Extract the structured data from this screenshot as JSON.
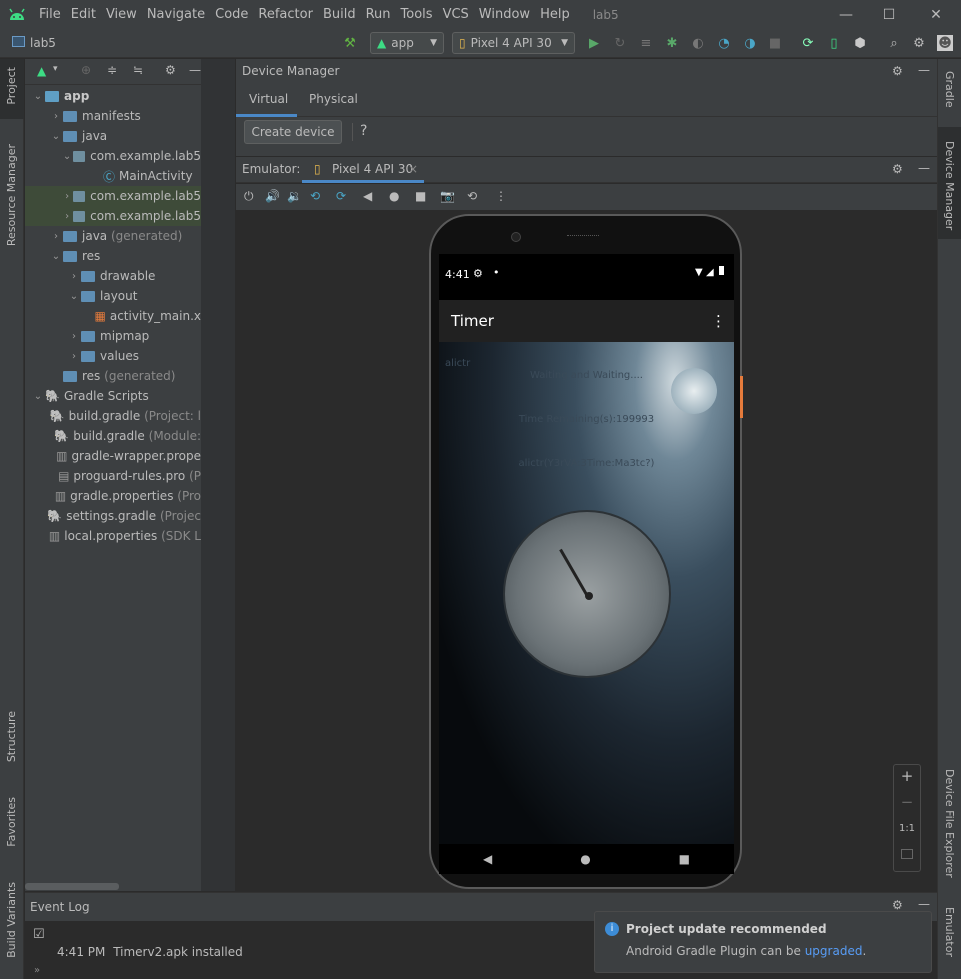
{
  "menu": {
    "items": [
      "File",
      "Edit",
      "View",
      "Navigate",
      "Code",
      "Refactor",
      "Build",
      "Run",
      "Tools",
      "VCS",
      "Window",
      "Help"
    ],
    "title": "lab5"
  },
  "toolbar": {
    "project": "lab5",
    "run_config": "app",
    "device": "Pixel 4 API 30"
  },
  "left_strip": {
    "project": "Project",
    "resource_manager": "Resource Manager",
    "structure": "Structure",
    "favorites": "Favorites",
    "build_variants": "Build Variants"
  },
  "right_strip": {
    "gradle": "Gradle",
    "device_manager": "Device Manager",
    "device_file_explorer": "Device File Explorer",
    "emulator": "Emulator"
  },
  "tree": [
    {
      "label": "app",
      "extra": ""
    },
    {
      "label": "manifests",
      "extra": ""
    },
    {
      "label": "java",
      "extra": ""
    },
    {
      "label": "com.example.lab5",
      "extra": ""
    },
    {
      "label": "MainActivity",
      "extra": ""
    },
    {
      "label": "com.example.lab5",
      "extra": ""
    },
    {
      "label": "com.example.lab5",
      "extra": ""
    },
    {
      "label": "java",
      "extra": "(generated)"
    },
    {
      "label": "res",
      "extra": ""
    },
    {
      "label": "drawable",
      "extra": ""
    },
    {
      "label": "layout",
      "extra": ""
    },
    {
      "label": "activity_main.x",
      "extra": ""
    },
    {
      "label": "mipmap",
      "extra": ""
    },
    {
      "label": "values",
      "extra": ""
    },
    {
      "label": "res",
      "extra": "(generated)"
    },
    {
      "label": "Gradle Scripts",
      "extra": ""
    },
    {
      "label": "build.gradle",
      "extra": "(Project: l"
    },
    {
      "label": "build.gradle",
      "extra": "(Module:"
    },
    {
      "label": "gradle-wrapper.prope",
      "extra": ""
    },
    {
      "label": "proguard-rules.pro",
      "extra": "(P"
    },
    {
      "label": "gradle.properties",
      "extra": "(Pro"
    },
    {
      "label": "settings.gradle",
      "extra": "(Projec"
    },
    {
      "label": "local.properties",
      "extra": "(SDK L"
    }
  ],
  "device_manager": {
    "title": "Device Manager",
    "tabs": [
      "Virtual",
      "Physical"
    ],
    "create_button": "Create device",
    "help": "?"
  },
  "emulator": {
    "label": "Emulator:",
    "tab": "Pixel 4 API 30",
    "close": "×"
  },
  "phone": {
    "time": "4:41",
    "app_title": "Timer",
    "line1": "Waiting and Waiting....",
    "line2": "Time Remaining(s):199993",
    "line3": "alictr(Y3rVA:3Time:Ma3tc?)",
    "overflow_text": "alictr"
  },
  "zoom": {
    "plus": "+",
    "minus": "−",
    "one": "1:1"
  },
  "event_log": {
    "title": "Event Log",
    "entry_time": "4:41 PM",
    "entry_text": "Timerv2.apk installed"
  },
  "notification": {
    "title": "Project update recommended",
    "text": "Android Gradle Plugin can be",
    "link": "upgraded",
    "suffix": "."
  }
}
